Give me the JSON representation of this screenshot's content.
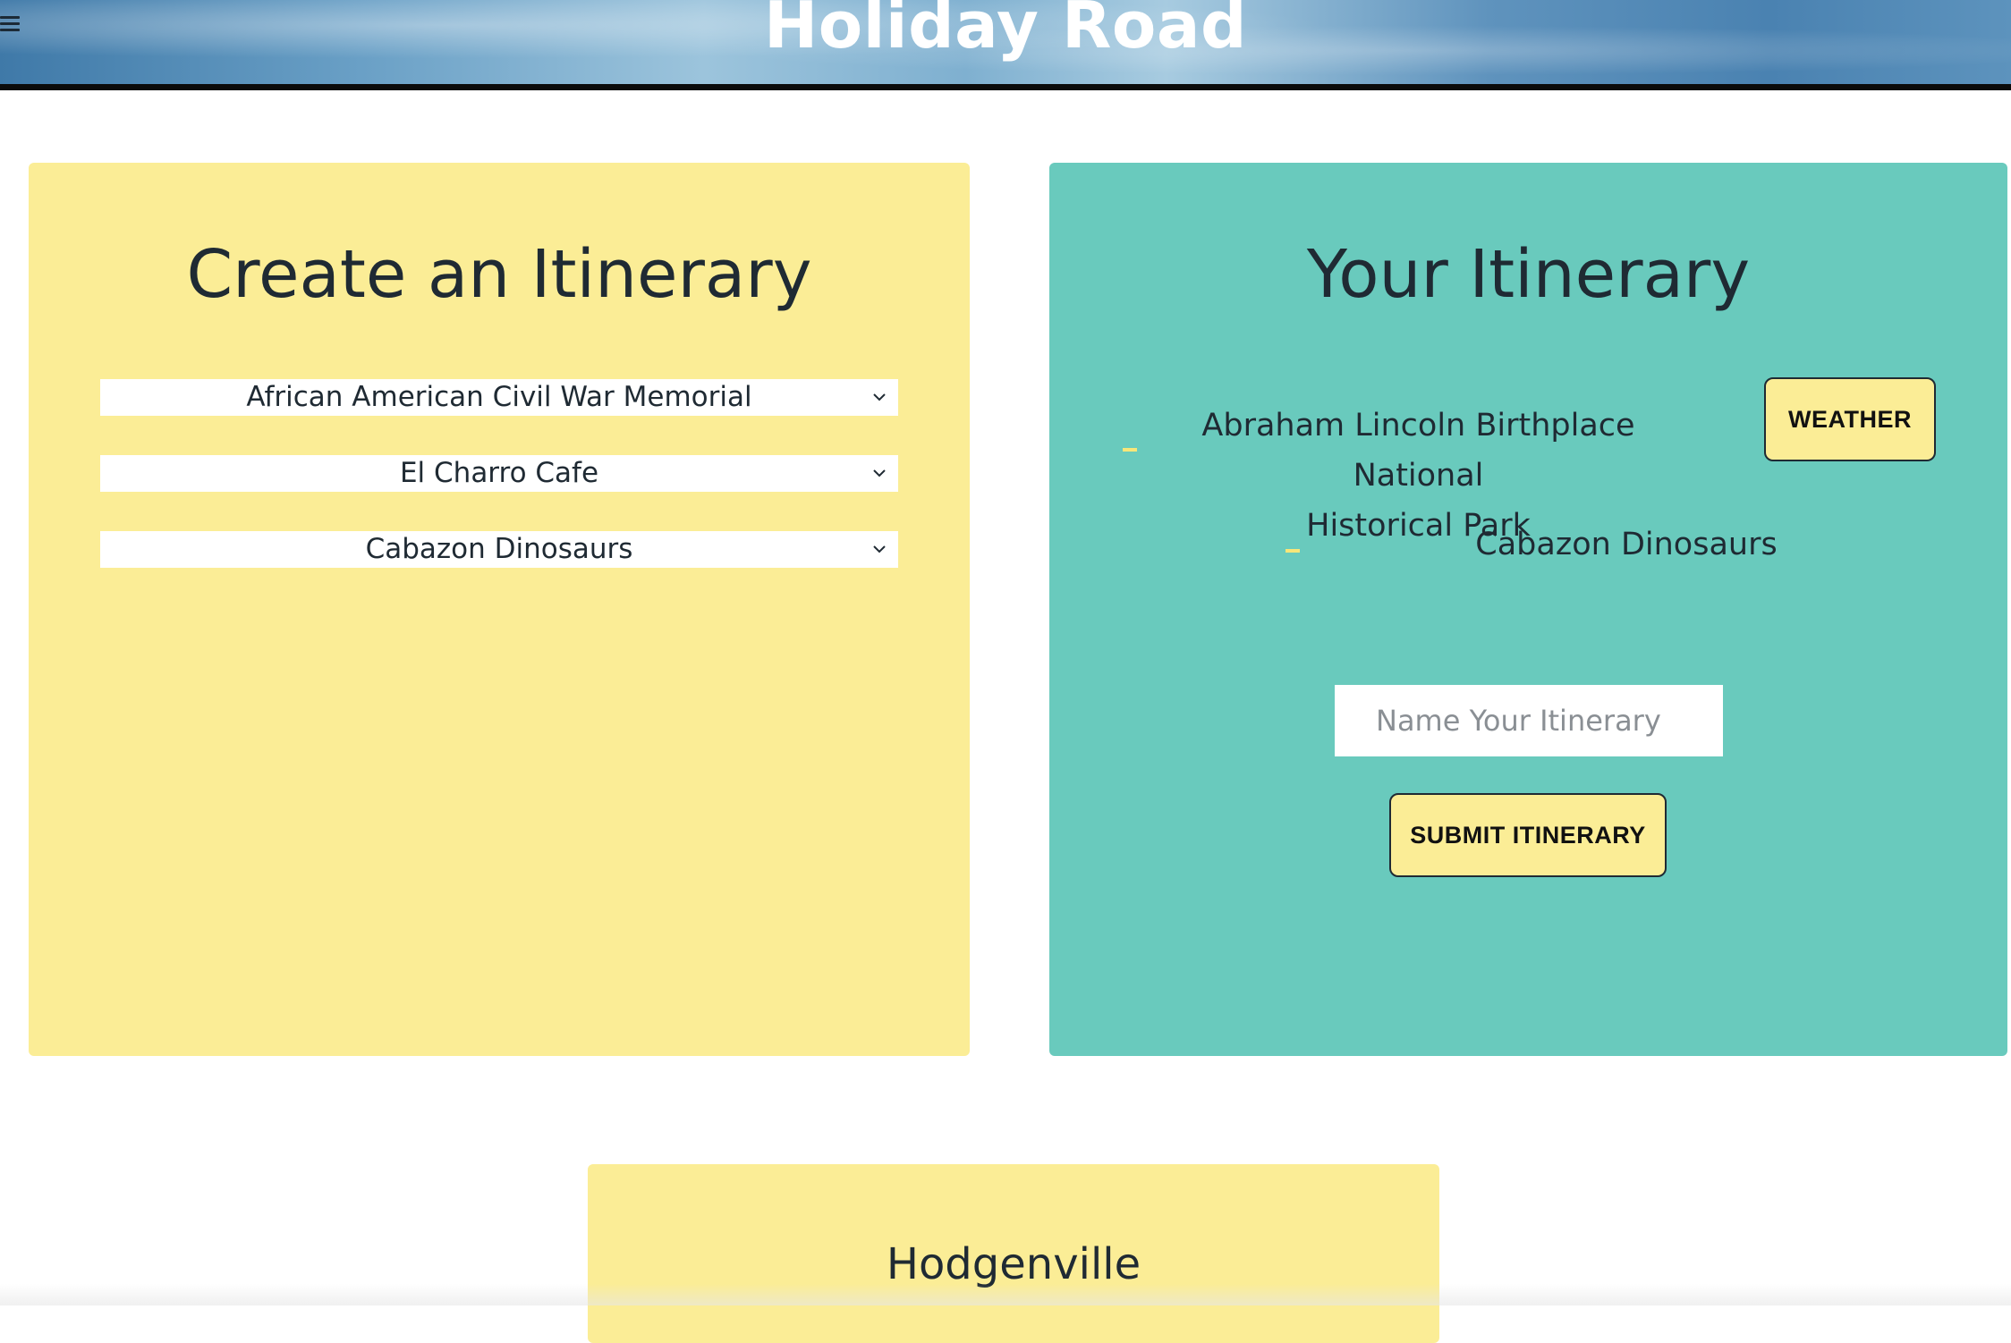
{
  "header": {
    "title": "Holiday Road",
    "menu_icon": "hamburger-menu-icon"
  },
  "create_panel": {
    "title": "Create an Itinerary",
    "selects": [
      {
        "selected": "African American Civil War Memorial"
      },
      {
        "selected": "El Charro Cafe"
      },
      {
        "selected": "Cabazon Dinosaurs"
      }
    ]
  },
  "itinerary_panel": {
    "title": "Your Itinerary",
    "items": [
      {
        "line1": "Abraham Lincoln Birthplace National",
        "line2": "Historical Park"
      },
      {
        "line1": "Cabazon Dinosaurs"
      }
    ],
    "weather_label": "WEATHER",
    "name_placeholder": "Name Your Itinerary",
    "submit_label": "SUBMIT ITINERARY"
  },
  "city_panel": {
    "title": "Hodgenville"
  },
  "colors": {
    "yellow_panel": "#fbed96",
    "teal_panel": "#69cabd",
    "text": "#1f2a33"
  }
}
